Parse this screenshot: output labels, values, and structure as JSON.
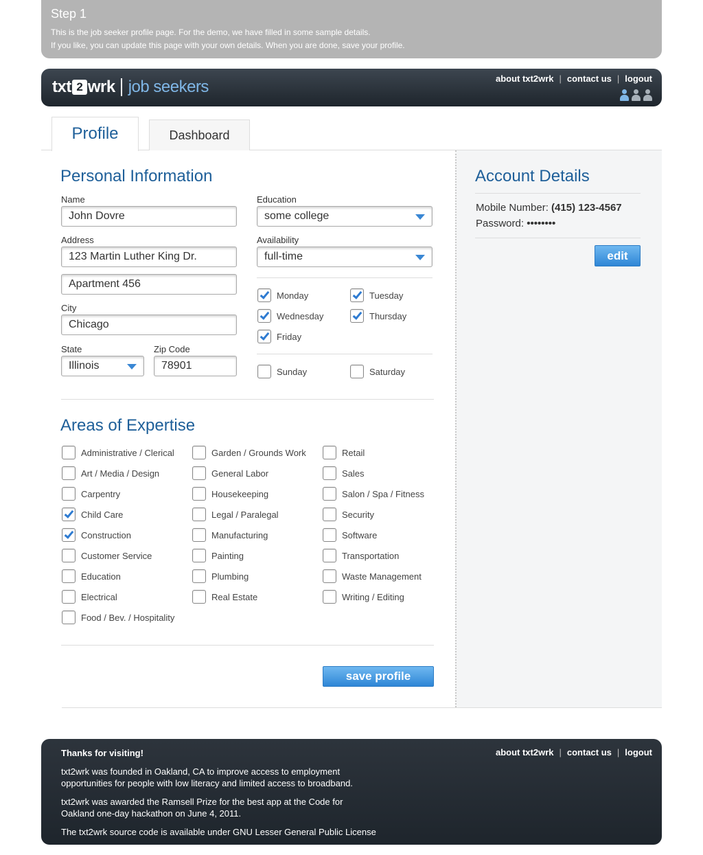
{
  "banner": {
    "title": "Step 1",
    "line1": "This is the job seeker profile page. For the demo, we have filled in some sample details.",
    "line2": "If you like, you can update this page with your own details. When you are done, save your profile."
  },
  "header": {
    "logo_txt": "txt",
    "logo_two": "2",
    "logo_wrk": "wrk",
    "logo_section": "job seekers",
    "links": {
      "about": "about txt2wrk",
      "contact": "contact us",
      "logout": "logout",
      "sep": "|"
    }
  },
  "tabs": {
    "profile": "Profile",
    "dashboard": "Dashboard"
  },
  "personal": {
    "heading": "Personal Information",
    "name": {
      "label": "Name",
      "value": "John Dovre"
    },
    "address": {
      "label": "Address",
      "line1": "123 Martin Luther King Dr.",
      "line2": "Apartment 456"
    },
    "city": {
      "label": "City",
      "value": "Chicago"
    },
    "state": {
      "label": "State",
      "value": "Illinois"
    },
    "zip": {
      "label": "Zip Code",
      "value": "78901"
    },
    "education": {
      "label": "Education",
      "value": "some college"
    },
    "availability": {
      "label": "Availability",
      "value": "full-time"
    },
    "days": [
      {
        "label": "Monday",
        "checked": true
      },
      {
        "label": "Tuesday",
        "checked": true
      },
      {
        "label": "Wednesday",
        "checked": true
      },
      {
        "label": "Thursday",
        "checked": true
      },
      {
        "label": "Friday",
        "checked": true
      },
      {
        "label": "Sunday",
        "checked": false
      },
      {
        "label": "Saturday",
        "checked": false
      }
    ]
  },
  "expertise": {
    "heading": "Areas of Expertise",
    "items": [
      {
        "label": "Administrative / Clerical",
        "checked": false
      },
      {
        "label": "Art / Media / Design",
        "checked": false
      },
      {
        "label": "Carpentry",
        "checked": false
      },
      {
        "label": "Child Care",
        "checked": true
      },
      {
        "label": "Construction",
        "checked": true
      },
      {
        "label": "Customer Service",
        "checked": false
      },
      {
        "label": "Education",
        "checked": false
      },
      {
        "label": "Electrical",
        "checked": false
      },
      {
        "label": "Food / Bev. / Hospitality",
        "checked": false
      },
      {
        "label": "Garden / Grounds Work",
        "checked": false
      },
      {
        "label": "General Labor",
        "checked": false
      },
      {
        "label": "Housekeeping",
        "checked": false
      },
      {
        "label": "Legal / Paralegal",
        "checked": false
      },
      {
        "label": "Manufacturing",
        "checked": false
      },
      {
        "label": "Painting",
        "checked": false
      },
      {
        "label": "Plumbing",
        "checked": false
      },
      {
        "label": "Real Estate",
        "checked": false
      },
      {
        "label": "Retail",
        "checked": false
      },
      {
        "label": "Sales",
        "checked": false
      },
      {
        "label": "Salon / Spa / Fitness",
        "checked": false
      },
      {
        "label": "Security",
        "checked": false
      },
      {
        "label": "Software",
        "checked": false
      },
      {
        "label": "Transportation",
        "checked": false
      },
      {
        "label": "Waste Management",
        "checked": false
      },
      {
        "label": "Writing / Editing",
        "checked": false
      }
    ],
    "save_label": "save profile"
  },
  "account": {
    "heading": "Account Details",
    "mobile_label": "Mobile Number:",
    "mobile_value": "(415) 123-4567",
    "password_label": "Password:",
    "password_value": "••••••••",
    "edit_label": "edit"
  },
  "footer": {
    "thanks": "Thanks for visiting!",
    "p1a": "txt2wrk was founded in Oakland, CA to improve access to employment",
    "p1b": "opportunities for people with low literacy and limited access to broadband.",
    "p2a": "txt2wrk was awarded the Ramsell Prize for the best app at the Code for",
    "p2b": "Oakland one-day hackathon on June 4, 2011.",
    "p3": "The txt2wrk source code is available under GNU Lesser General Public License"
  },
  "colors": {
    "accent": "#1e5f99",
    "check": "#2e7bd1",
    "header_bg": "#1e252c",
    "banner_bg": "#b4b4b4",
    "people_active": "#7fb6e6",
    "people_inactive": "#a7b0b8"
  }
}
